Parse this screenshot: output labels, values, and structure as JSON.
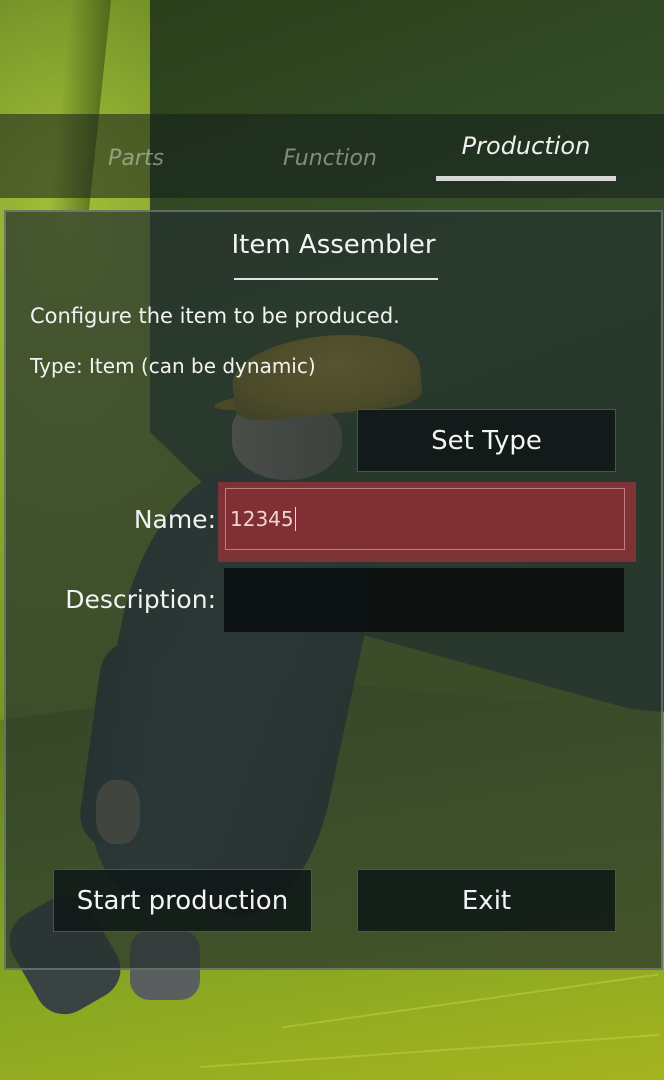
{
  "tabs": [
    {
      "label": "Parts"
    },
    {
      "label": "Function"
    },
    {
      "label": "Production"
    }
  ],
  "active_tab": "Production",
  "panel": {
    "title": "Item Assembler",
    "description": "Configure the item to be produced.",
    "type_text": "Type: Item (can be dynamic)",
    "set_type_label": "Set Type",
    "name_label": "Name:",
    "name_value": "12345",
    "description_label": "Description:",
    "description_value": "",
    "start_label": "Start production",
    "exit_label": "Exit"
  },
  "colors": {
    "panel_bg": "#26302e",
    "name_field_highlight": "#96323a",
    "button_bg": "#0e1616",
    "scene_green": "#7c9a20",
    "helmet_yellow": "#d9b534"
  }
}
